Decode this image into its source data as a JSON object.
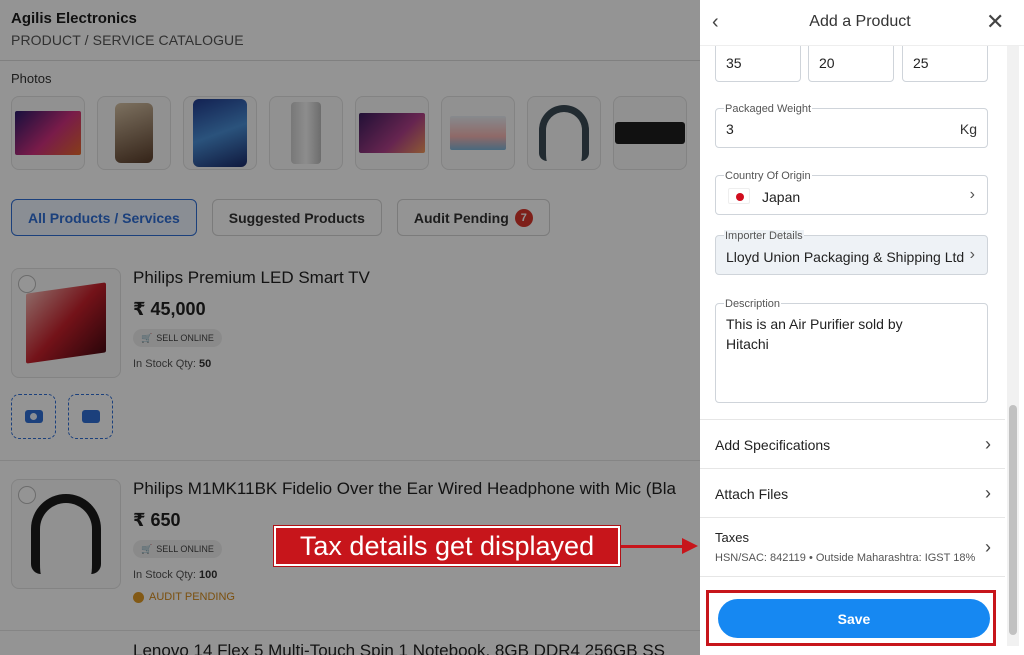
{
  "company": {
    "name": "Agilis Electronics",
    "subtitle": "PRODUCT / SERVICE CATALOGUE"
  },
  "photos": {
    "label": "Photos",
    "items": [
      "tv-icon",
      "phone-icon",
      "phone-icon",
      "air-purifier-icon",
      "tv-icon",
      "tv-icon",
      "headphones-icon",
      "soundbar-icon"
    ]
  },
  "filters": {
    "all": "All Products / Services",
    "suggested": "Suggested Products",
    "audit": "Audit Pending",
    "audit_count": "7"
  },
  "products": [
    {
      "title": "Philips Premium LED Smart TV",
      "price": "₹ 45,000",
      "sell_label": "SELL ONLINE",
      "stock_label": "In Stock Qty:",
      "stock_qty": "50"
    },
    {
      "title": "Philips M1MK11BK Fidelio Over the Ear Wired Headphone with Mic (Bla",
      "price": "₹ 650",
      "sell_label": "SELL ONLINE",
      "stock_label": "In Stock Qty:",
      "stock_qty": "100",
      "audit_label": "AUDIT PENDING"
    },
    {
      "title": "Lenovo 14 Flex 5 Multi-Touch Spin 1 Notebook, 8GB DDR4 256GB SS"
    }
  ],
  "drawer": {
    "title": "Add a Product",
    "dimensions": [
      "35",
      "20",
      "25"
    ],
    "packaged_weight": {
      "label": "Packaged Weight",
      "value": "3",
      "unit": "Kg"
    },
    "country": {
      "label": "Country Of Origin",
      "value": "Japan"
    },
    "importer": {
      "label": "Importer Details",
      "value": "Lloyd Union Packaging & Shipping Ltd"
    },
    "description": {
      "label": "Description",
      "value": "This is an Air Purifier sold by\nHitachi"
    },
    "rows": {
      "specs": "Add Specifications",
      "files": "Attach Files"
    },
    "taxes": {
      "label": "Taxes",
      "details": "HSN/SAC: 842119  •  Outside Maharashtra: IGST 18%"
    },
    "save_label": "Save"
  },
  "annotation": {
    "text": "Tax details get displayed",
    "color": "#c7151b"
  },
  "colors": {
    "accent": "#1688f2",
    "highlight": "#c7151b"
  }
}
